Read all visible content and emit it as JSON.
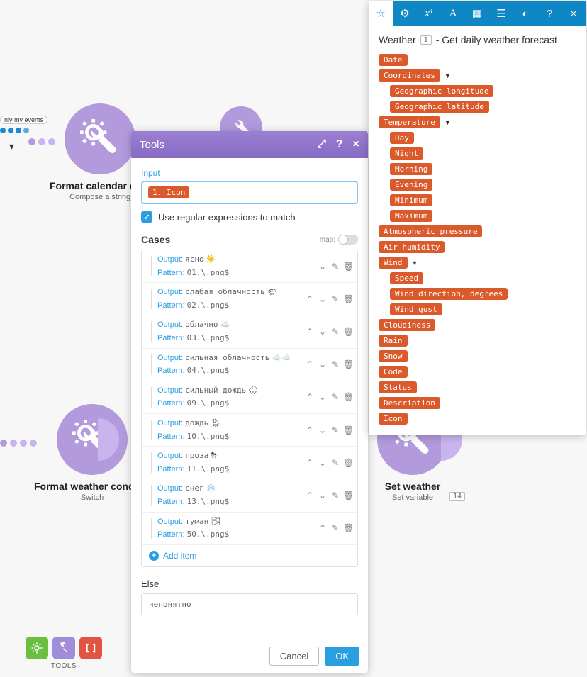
{
  "workflow": {
    "node1": {
      "title": "Format calendar ev…",
      "sub": "Compose a string"
    },
    "node2": {
      "title": "Format weather condit…",
      "sub": "Switch"
    },
    "node3": {
      "title": "Set weather",
      "sub": "Set variable",
      "badge": "14"
    },
    "filter_label": "nly my events"
  },
  "toolbar": {
    "label": "TOOLS"
  },
  "modal": {
    "title": "Tools",
    "input_label": "Input",
    "input_tag": "1. Icon",
    "regex_label": "Use regular expressions to match",
    "cases_label": "Cases",
    "map_label": "map:",
    "output_lbl": "Output:",
    "pattern_lbl": "Pattern:",
    "cases": [
      {
        "output": "ясно",
        "emoji": "☀️",
        "pattern": "01.\\.png$",
        "first": true
      },
      {
        "output": "слабая облачность",
        "emoji": "🌤",
        "pattern": "02.\\.png$"
      },
      {
        "output": "облачно",
        "emoji": "☁️",
        "pattern": "03.\\.png$"
      },
      {
        "output": "сильная облачность",
        "emoji": "☁️☁️",
        "pattern": "04.\\.png$"
      },
      {
        "output": "сильный дождь",
        "emoji": "🌧",
        "pattern": "09.\\.png$"
      },
      {
        "output": "дождь",
        "emoji": "🌦",
        "pattern": "10.\\.png$"
      },
      {
        "output": "гроза",
        "emoji": "⛈",
        "pattern": "11.\\.png$"
      },
      {
        "output": "снег",
        "emoji": "❄️",
        "pattern": "13.\\.png$"
      },
      {
        "output": "туман",
        "emoji": "🌫",
        "pattern": "50.\\.png$",
        "last": true
      }
    ],
    "add_item": "Add item",
    "else_label": "Else",
    "else_value": "непонятно",
    "cancel": "Cancel",
    "ok": "OK"
  },
  "panel": {
    "title_prefix": "Weather",
    "title_badge": "1",
    "title_suffix": "- Get daily weather forecast",
    "tree": [
      {
        "label": "Date"
      },
      {
        "label": "Coordinates",
        "exp": true,
        "children": [
          "Geographic longitude",
          "Geographic latitude"
        ]
      },
      {
        "label": "Temperature",
        "exp": true,
        "children": [
          "Day",
          "Night",
          "Morning",
          "Evening",
          "Minimum",
          "Maximum"
        ]
      },
      {
        "label": "Atmospheric pressure"
      },
      {
        "label": "Air humidity"
      },
      {
        "label": "Wind",
        "exp": true,
        "children": [
          "Speed",
          "Wind direction, degrees",
          "Wind gust"
        ]
      },
      {
        "label": "Cloudiness"
      },
      {
        "label": "Rain"
      },
      {
        "label": "Snow"
      },
      {
        "label": "Code"
      },
      {
        "label": "Status"
      },
      {
        "label": "Description"
      },
      {
        "label": "Icon"
      }
    ]
  }
}
